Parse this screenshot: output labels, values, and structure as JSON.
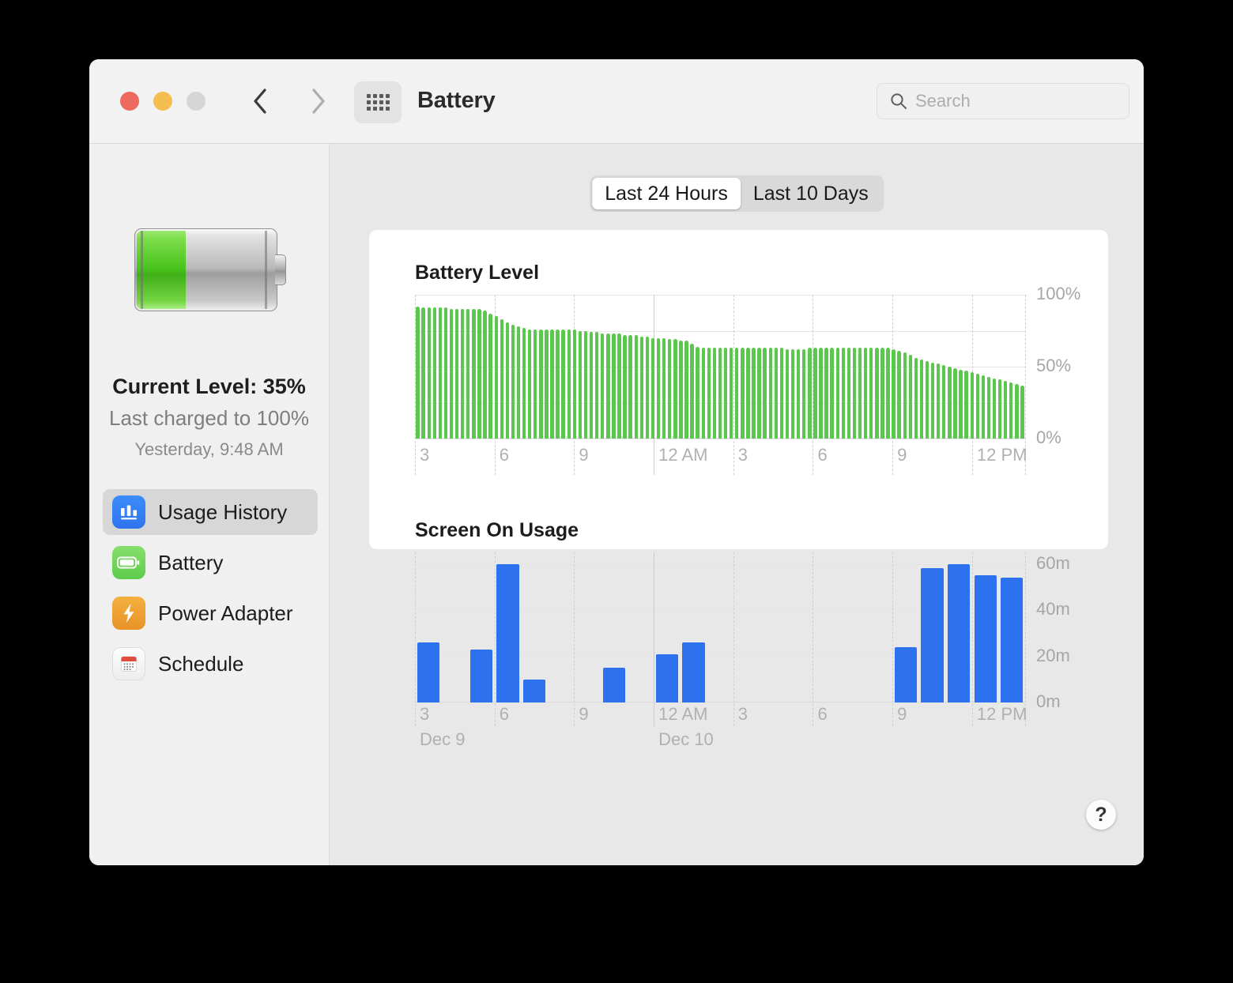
{
  "window": {
    "title": "Battery",
    "traffic_lights": [
      "close-button",
      "minimize-button",
      "zoom-button"
    ],
    "back_label": "Back",
    "forward_label": "Forward",
    "grid_label": "Show All"
  },
  "search": {
    "placeholder": "Search",
    "value": ""
  },
  "sidebar": {
    "current_level": "Current Level: 35%",
    "last_charged": "Last charged to 100%",
    "charged_when": "Yesterday, 9:48 AM",
    "battery_fill_percent": 35,
    "items": [
      {
        "label": "Usage History",
        "icon": "bar-chart-icon",
        "selected": true
      },
      {
        "label": "Battery",
        "icon": "battery-icon",
        "selected": false
      },
      {
        "label": "Power Adapter",
        "icon": "bolt-icon",
        "selected": false
      },
      {
        "label": "Schedule",
        "icon": "calendar-icon",
        "selected": false
      }
    ]
  },
  "segmented": {
    "options": [
      "Last 24 Hours",
      "Last 10 Days"
    ],
    "selected": "Last 24 Hours"
  },
  "help": {
    "label": "?"
  },
  "colors": {
    "battery_green": "#5BC74C",
    "usage_blue": "#2D71EF",
    "accent_blue": "#2F74EE",
    "window_bg": "#ECECEC",
    "content_bg": "#E8E8E8"
  },
  "chart_data": [
    {
      "type": "bar",
      "title": "Battery Level",
      "xlabel": "",
      "ylabel": "",
      "ylim": [
        0,
        100
      ],
      "yticks": [
        0,
        50,
        100
      ],
      "ytick_labels": [
        "0%",
        "50%",
        "100%"
      ],
      "gridlines_y": [
        0,
        25,
        50,
        75,
        100
      ],
      "xtick_labels": [
        "3",
        "6",
        "9",
        "12 AM",
        "3",
        "6",
        "9",
        "12 PM"
      ],
      "xtick_hours": [
        3,
        6,
        9,
        12,
        15,
        18,
        21,
        24
      ],
      "day_boundary_label": "12 AM",
      "x_start_hour": 3,
      "x_end_hour": 26,
      "bar_color": "#5BC74C",
      "values": [
        92,
        91,
        91,
        91,
        91,
        91,
        90,
        90,
        90,
        90,
        90,
        90,
        89,
        87,
        85,
        83,
        81,
        79,
        78,
        77,
        76,
        76,
        76,
        76,
        76,
        76,
        76,
        76,
        76,
        75,
        75,
        74,
        74,
        73,
        73,
        73,
        73,
        72,
        72,
        72,
        71,
        71,
        70,
        70,
        70,
        69,
        69,
        68,
        68,
        66,
        64,
        63,
        63,
        63,
        63,
        63,
        63,
        63,
        63,
        63,
        63,
        63,
        63,
        63,
        63,
        63,
        62,
        62,
        62,
        62,
        63,
        63,
        63,
        63,
        63,
        63,
        63,
        63,
        63,
        63,
        63,
        63,
        63,
        63,
        63,
        62,
        61,
        60,
        58,
        56,
        55,
        54,
        53,
        52,
        51,
        50,
        49,
        48,
        47,
        46,
        45,
        44,
        43,
        42,
        41,
        40,
        39,
        38,
        37
      ]
    },
    {
      "type": "bar",
      "title": "Screen On Usage",
      "xlabel": "",
      "ylabel": "",
      "ylim": [
        0,
        65
      ],
      "yticks": [
        0,
        20,
        40,
        60
      ],
      "ytick_labels": [
        "0m",
        "20m",
        "40m",
        "60m"
      ],
      "gridlines_y": [
        0,
        20,
        40,
        60
      ],
      "xtick_labels": [
        "3",
        "6",
        "9",
        "12 AM",
        "3",
        "6",
        "9",
        "12 PM"
      ],
      "xtick_hours": [
        3,
        6,
        9,
        12,
        15,
        18,
        21,
        24
      ],
      "date_labels": [
        {
          "text": "Dec 9",
          "hour": 3
        },
        {
          "text": "Dec 10",
          "hour": 12
        }
      ],
      "x_start_hour": 3,
      "x_end_hour": 26,
      "bar_color": "#2D71EF",
      "unit": "minutes",
      "bars": [
        {
          "hour": 3,
          "value": 26
        },
        {
          "hour": 5,
          "value": 23
        },
        {
          "hour": 6,
          "value": 60
        },
        {
          "hour": 7,
          "value": 10
        },
        {
          "hour": 10,
          "value": 15
        },
        {
          "hour": 12,
          "value": 21
        },
        {
          "hour": 13,
          "value": 26
        },
        {
          "hour": 21,
          "value": 24
        },
        {
          "hour": 22,
          "value": 58
        },
        {
          "hour": 23,
          "value": 60
        },
        {
          "hour": 24,
          "value": 55
        },
        {
          "hour": 25,
          "value": 54
        }
      ]
    }
  ]
}
